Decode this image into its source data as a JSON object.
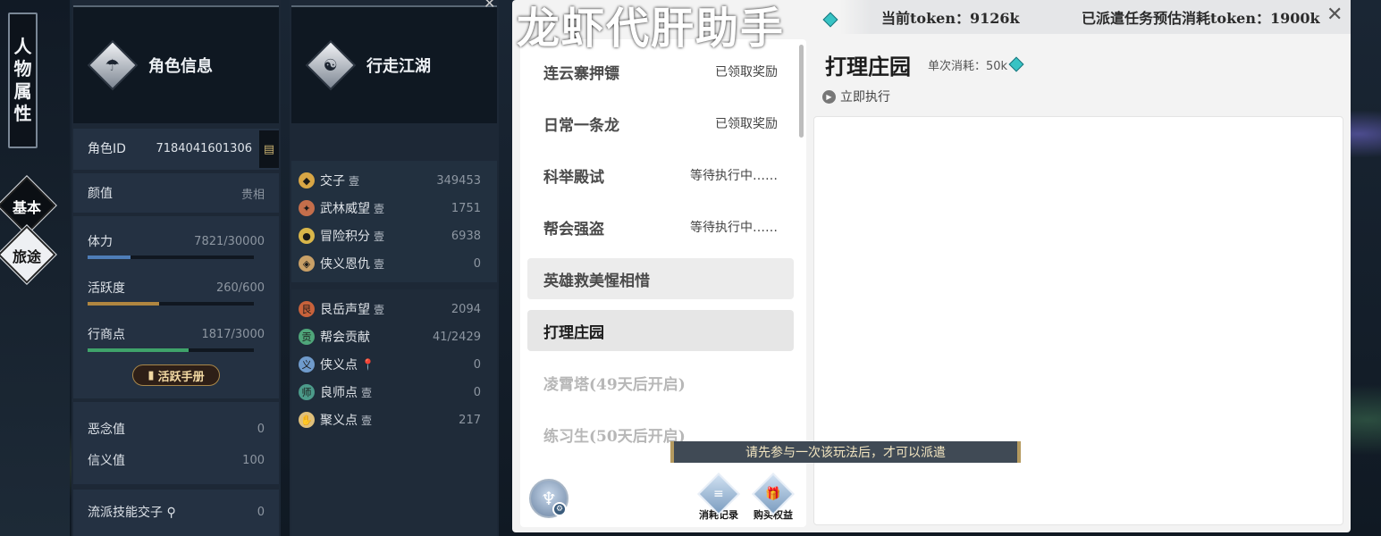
{
  "sidebar": {
    "vertical_title": [
      "人",
      "物",
      "属",
      "性"
    ],
    "tabs": [
      {
        "label": "基本"
      },
      {
        "label": "旅途"
      }
    ]
  },
  "character": {
    "header": "角色信息",
    "id_label": "角色ID",
    "id_value": "7184041601306",
    "looks_label": "颜值",
    "looks_value": "贵相",
    "stats": [
      {
        "label": "体力",
        "value": "7821/30000",
        "fill": 0.26,
        "color": "#4e7db8"
      },
      {
        "label": "活跃度",
        "value": "260/600",
        "fill": 0.43,
        "color": "#b08640"
      },
      {
        "label": "行商点",
        "value": "1817/3000",
        "fill": 0.61,
        "color": "#3fa36a"
      }
    ],
    "handbook_label": "活跃手册",
    "karma_label": "恶念值",
    "karma_value": "0",
    "trust_label": "信义值",
    "trust_value": "100",
    "skill_coin_label": "流派技能交子",
    "skill_coin_value": "0"
  },
  "journey": {
    "header": "行走江湖",
    "group1": [
      {
        "label": "交子",
        "tag": "壹",
        "value": "349453",
        "color": "#d8a645",
        "glyph": "◆"
      },
      {
        "label": "武林威望",
        "tag": "壹",
        "value": "1751",
        "color": "#c46e4b",
        "glyph": "✦"
      },
      {
        "label": "冒险积分",
        "tag": "壹",
        "value": "6938",
        "color": "#d9b64a",
        "glyph": "●"
      },
      {
        "label": "侠义恩仇",
        "tag": "壹",
        "value": "0",
        "color": "#c9a067",
        "glyph": "◈"
      }
    ],
    "group2": [
      {
        "label": "艮岳声望",
        "tag": "壹",
        "value": "2094",
        "color": "#c8623b",
        "glyph": "艮"
      },
      {
        "label": "帮会贡献",
        "tag": "",
        "value": "41/2429",
        "color": "#4fa67a",
        "glyph": "贡"
      },
      {
        "label": "侠义点",
        "tag": "📍",
        "value": "0",
        "color": "#6f9bcc",
        "glyph": "义"
      },
      {
        "label": "良师点",
        "tag": "壹",
        "value": "0",
        "color": "#4c9b8a",
        "glyph": "师"
      },
      {
        "label": "聚义点",
        "tag": "壹",
        "value": "217",
        "color": "#e0c07a",
        "glyph": "✋"
      }
    ]
  },
  "assistant": {
    "title": "龙虾代肝助手",
    "current_token": "当前token：9126k",
    "dispatch_token": "已派遣任务预估消耗token：1900k",
    "tasks": [
      {
        "name": "连云寨押镖",
        "status": "已领取奖励",
        "style": "normal"
      },
      {
        "name": "日常一条龙",
        "status": "已领取奖励",
        "style": "normal"
      },
      {
        "name": "科举殿试",
        "status": "等待执行中……",
        "style": "normal"
      },
      {
        "name": "帮会强盗",
        "status": "等待执行中……",
        "style": "normal"
      },
      {
        "name": "英雄救美惺相惜",
        "status": "",
        "style": "grey"
      },
      {
        "name": "打理庄园",
        "status": "",
        "style": "sel"
      },
      {
        "name": "凌霄塔(49天后开启)",
        "status": "",
        "style": "dis"
      },
      {
        "name": "练习生(50天后开启)",
        "status": "",
        "style": "dis"
      }
    ],
    "toast": "请先参与一次该玩法后，才可以派遣",
    "footer_buttons": [
      {
        "label": "消耗记录",
        "icon": "≡"
      },
      {
        "label": "购买权益",
        "icon": "🎁"
      }
    ],
    "detail": {
      "title": "打理庄园",
      "cost": "单次消耗：50k",
      "execute": "立即执行"
    }
  }
}
